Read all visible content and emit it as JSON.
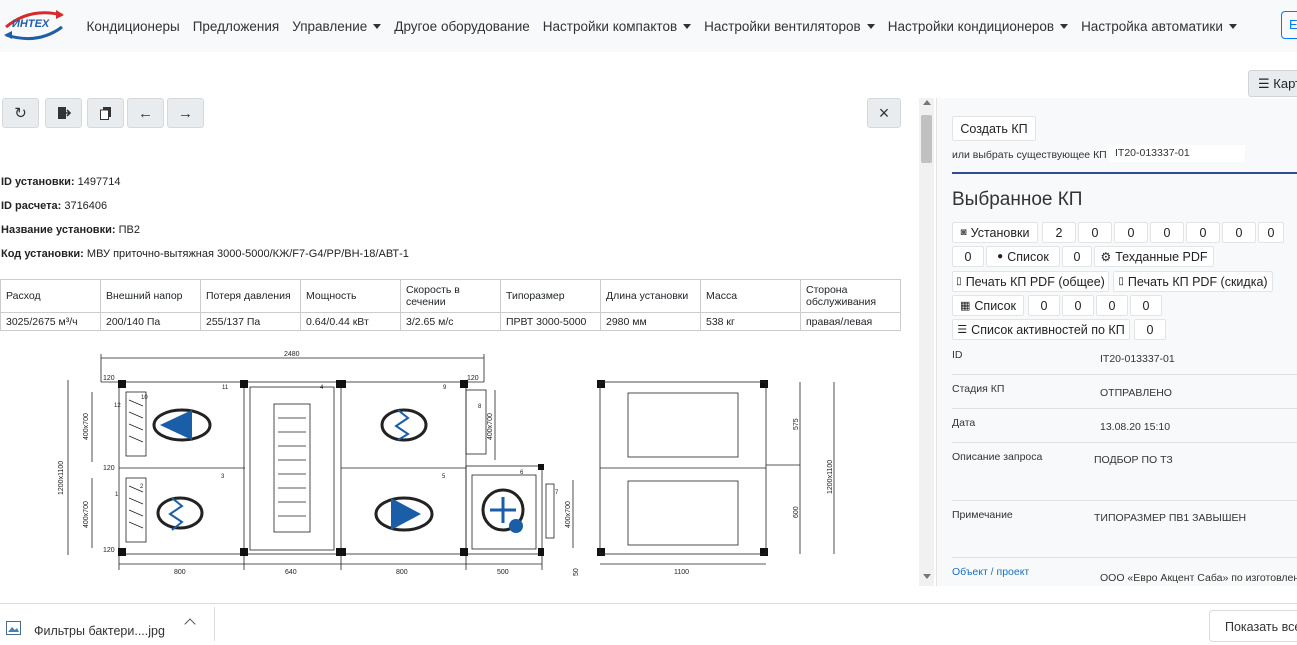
{
  "navbar": {
    "logo_text": "ИНТЕХ",
    "items": [
      {
        "label": "Кондиционеры",
        "dropdown": false
      },
      {
        "label": "Предложения",
        "dropdown": false
      },
      {
        "label": "Управление",
        "dropdown": true
      },
      {
        "label": "Другое оборудование",
        "dropdown": false
      },
      {
        "label": "Настройки компактов",
        "dropdown": true
      },
      {
        "label": "Настройки вентиляторов",
        "dropdown": true
      },
      {
        "label": "Настройки кондиционеров",
        "dropdown": true
      },
      {
        "label": "Настройка автоматики",
        "dropdown": true
      }
    ],
    "right_button": "E",
    "map_button": "Карт"
  },
  "toolbar": {
    "icons": [
      "refresh-icon",
      "export-icon",
      "copy-icon",
      "arrow-left-icon",
      "arrow-right-icon"
    ],
    "close": "×"
  },
  "info": {
    "unit_id_label": "ID установки:",
    "unit_id": "1497714",
    "calc_id_label": "ID расчета:",
    "calc_id": "3716406",
    "name_label": "Название установки:",
    "name": "ПВ2",
    "code_label": "Код установки:",
    "code": "МВУ приточно-вытяжная 3000-5000/КЖ/F7-G4/PP/ВН-18/АВТ-1"
  },
  "params_table": {
    "headers": [
      "Расход",
      "Внешний напор",
      "Потеря давления",
      "Мощность",
      "Скорость в сечении",
      "Типоразмер",
      "Длина установки",
      "Масса",
      "Сторона обслуживания"
    ],
    "values": [
      "3025/2675 м³/ч",
      "200/140 Па",
      "255/137 Па",
      "0.64/0.44 кВт",
      "3/2.65 м/с",
      "ПРВТ 3000-5000",
      "2980 мм",
      "538 кг",
      "правая/левая"
    ]
  },
  "drawing": {
    "dims": {
      "total": "2480",
      "h1": "120",
      "h2": "120",
      "h_total_left": "1200x1100",
      "sec_top_l": "400x700",
      "sec_bot_l": "400x700",
      "sec_right": "400x700",
      "sec_right2": "400x700",
      "b1": "800",
      "b2": "640",
      "b3": "800",
      "b4": "500",
      "b5": "50",
      "b6": "120",
      "b7": "120",
      "side_w": "1100",
      "side_h": "1200x1100",
      "side_top": "575",
      "side_bot": "600"
    },
    "numbers": [
      "1",
      "2",
      "3",
      "4",
      "5",
      "6",
      "7",
      "8",
      "9",
      "10",
      "11",
      "12"
    ]
  },
  "panel": {
    "create_kp": "Создать КП",
    "choose_label": "или выбрать существующее КП",
    "choose_value": "IT20-013337-01",
    "title": "Выбранное КП",
    "units_label": "Установки",
    "units_counts": [
      "2",
      "0",
      "0",
      "0",
      "0",
      "0",
      "0"
    ],
    "row2_count1": "0",
    "list_label": "Список",
    "list_count": "0",
    "techpdf_label": "Техданные PDF",
    "print_general": "Печать КП PDF (общее)",
    "print_discount": "Печать КП PDF (скидка)",
    "list2_label": "Список",
    "list2_counts": [
      "0",
      "0",
      "0",
      "0"
    ],
    "activity_label": "Список активностей по КП",
    "activity_count": "0",
    "fields": [
      {
        "label": "ID",
        "value": "IT20-013337-01"
      },
      {
        "label": "Стадия КП",
        "value": "ОТПРАВЛЕНО"
      },
      {
        "label": "Дата",
        "value": "13.08.20 15:10"
      },
      {
        "label": "Описание запроса",
        "value": "ПОДБОР ПО ТЗ"
      },
      {
        "label": "Примечание",
        "value": "ТИПОРАЗМЕР ПВ1 ЗАВЫШЕН"
      }
    ],
    "object_link": "Объект / проект",
    "object_value": "ООО «Евро Акцент Саба» по изготовлен"
  },
  "download_bar": {
    "file_name": "Фильтры бактери....jpg",
    "show_all": "Показать все"
  },
  "colors": {
    "accent": "#1f5fa8",
    "link": "#1a6fc1",
    "fan_blue": "#1a5ea8"
  }
}
